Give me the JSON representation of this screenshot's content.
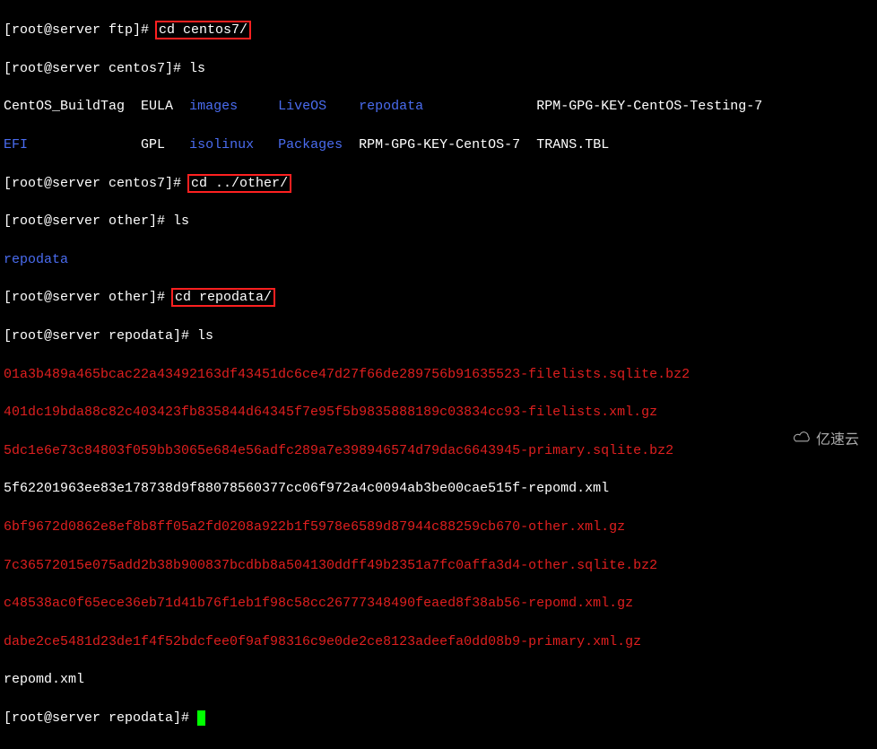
{
  "prompt_ftp": "[root@server ftp]# ",
  "prompt_centos7": "[root@server centos7]# ",
  "prompt_other": "[root@server other]# ",
  "prompt_repodata": "[root@server repodata]# ",
  "cmd_cd_centos7": "cd centos7/",
  "cmd_ls": "ls",
  "cmd_cd_other": "cd ../other/",
  "cmd_cd_repodata": "cd repodata/",
  "ls1_row1": {
    "c1": "CentOS_BuildTag",
    "c2": "EULA",
    "c3": "images",
    "c4": "LiveOS",
    "c5": "repodata",
    "c6": "RPM-GPG-KEY-CentOS-Testing-7"
  },
  "ls1_row2": {
    "c1": "EFI",
    "c2": "GPL",
    "c3": "isolinux",
    "c4": "Packages",
    "c5": "RPM-GPG-KEY-CentOS-7",
    "c6": "TRANS.TBL"
  },
  "ls_other_1": "repodata",
  "repo_files": {
    "f1": "01a3b489a465bcac22a43492163df43451dc6ce47d27f66de289756b91635523-filelists.sqlite.bz2",
    "f2": "401dc19bda88c82c403423fb835844d64345f7e95f5b9835888189c03834cc93-filelists.xml.gz",
    "f3": "5dc1e6e73c84803f059bb3065e684e56adfc289a7e398946574d79dac6643945-primary.sqlite.bz2",
    "f4": "5f62201963ee83e178738d9f88078560377cc06f972a4c0094ab3be00cae515f-repomd.xml",
    "f5": "6bf9672d0862e8ef8b8ff05a2fd0208a922b1f5978e6589d87944c88259cb670-other.xml.gz",
    "f6": "7c36572015e075add2b38b900837bcdbb8a504130ddff49b2351a7fc0affa3d4-other.sqlite.bz2",
    "f7": "c48538ac0f65ece36eb71d41b76f1eb1f98c58cc26777348490feaed8f38ab56-repomd.xml.gz",
    "f8": "dabe2ce5481d23de1f4f52bdcfee0f9af98316c9e0de2ce8123adeefa0dd08b9-primary.xml.gz",
    "f9": "repomd.xml"
  },
  "watermark": "亿速云"
}
